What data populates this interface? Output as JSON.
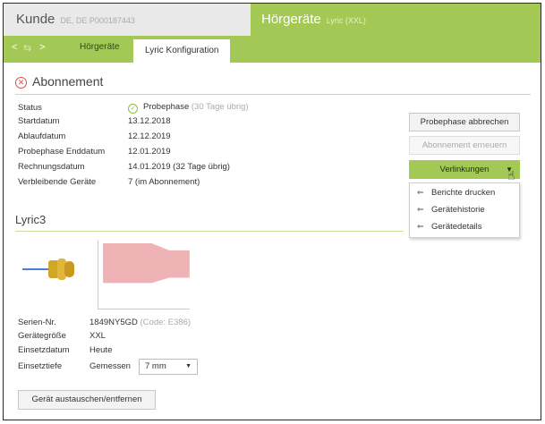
{
  "header": {
    "kunde_title": "Kunde",
    "kunde_sub": "DE, DE P000187443",
    "hg_title": "Hörgeräte",
    "hg_sub": "Lyric (XXL)"
  },
  "nav": {
    "back": "<",
    "swap": "⇆",
    "forward": ">",
    "tabs": [
      {
        "label": "Hörgeräte",
        "active": false
      },
      {
        "label": "Lyric Konfiguration",
        "active": true
      }
    ]
  },
  "abonnement": {
    "title": "Abonnement",
    "rows": [
      {
        "label": "Status",
        "value": "Probephase",
        "note": "(30 Tage übrig)"
      },
      {
        "label": "Startdatum",
        "value": "13.12.2018"
      },
      {
        "label": "Ablaufdatum",
        "value": "12.12.2019"
      },
      {
        "label": "Probephase Enddatum",
        "value": "12.01.2019"
      },
      {
        "label": "Rechnungsdatum",
        "value": "14.01.2019 (32 Tage übrig)"
      },
      {
        "label": "Verbleibende Geräte",
        "value": "7 (im Abonnement)"
      }
    ],
    "buttons": {
      "cancel_trial": "Probephase abbrechen",
      "renew": "Abonnement erneuern",
      "links": "Verlinkungen"
    },
    "links_menu": [
      "Berichte drucken",
      "Gerätehistorie",
      "Gerätedetails"
    ]
  },
  "lyric": {
    "title": "Lyric3",
    "details": [
      {
        "label": "Serien-Nr.",
        "value": "1849NY5GD",
        "note": "(Code: E386)"
      },
      {
        "label": "Gerätegröße",
        "value": "XXL"
      },
      {
        "label": "Einsetzdatum",
        "value": "Heute"
      }
    ],
    "depth_label": "Einsetztiefe",
    "depth_mode": "Gemessen",
    "depth_value": "7 mm",
    "replace_button": "Gerät austauschen/entfernen"
  },
  "colors": {
    "accent_green": "#a3c856",
    "header_gray": "#e9e9e9",
    "error_red": "#d65353",
    "ok_green": "#8cbf3f",
    "chart_pink": "#f0b3b5",
    "device_gold": "#d2a726",
    "device_blue": "#4a7de0"
  },
  "icons": [
    "error-circle-icon",
    "check-circle-icon",
    "caret-down-icon",
    "link-icon",
    "hand-cursor-icon",
    "hearing-aid-device-icon"
  ]
}
